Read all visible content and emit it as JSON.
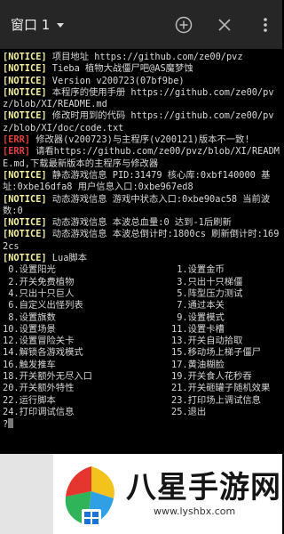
{
  "titlebar": {
    "window_label": "窗口 1",
    "icons": [
      "chevron-down-icon",
      "plus-circle-icon",
      "close-icon",
      "more-vert-icon"
    ]
  },
  "colors": {
    "notice": "#f5f0a0",
    "error": "#e04040",
    "text": "#d8d8d8",
    "background": "#000000",
    "titlebar": "#262626"
  },
  "terminal": {
    "log": [
      {
        "tag": "[NOTICE]",
        "type": "notice",
        "text": " 项目地址 https://github.com/ze00/pvz"
      },
      {
        "tag": "[NOTICE]",
        "type": "notice",
        "text": " Tieba 植物大战僵尸吧@AS魔梦蚀"
      },
      {
        "tag": "[NOTICE]",
        "type": "notice",
        "text": " Version v200723(07bf9be)"
      },
      {
        "tag": "[NOTICE]",
        "type": "notice",
        "text": " 本程序的使用手册 https://github.com/ze00/pvz/blob/XI/README.md"
      },
      {
        "tag": "[NOTICE]",
        "type": "notice",
        "text": " 修改时用到的代码 https://github.com/ze00/pvz/blob/XI/doc/code.txt"
      },
      {
        "tag": "[ERR]",
        "type": "err",
        "text": " 修改器(v200723)与主程序(v200121)版本不一致!"
      },
      {
        "tag": "[ERR]",
        "type": "err",
        "text": " 请看https://github.com/ze00/pvz/blob/XI/README.md,下载最新版本的主程序与修改器"
      },
      {
        "tag": "[NOTICE]",
        "type": "notice",
        "text": " 静态游戏信息 PID:31479 核心库:0xbf140000 基址:0xbe16dfa8 用户信息入口:0xbe967ed8"
      },
      {
        "tag": "[NOTICE]",
        "type": "notice",
        "text": " 动态游戏信息 游戏中状态入口:0xbe90ac58 当前波数:0"
      },
      {
        "tag": "[NOTICE]",
        "type": "notice",
        "text": " 动态游戏信息 本波总血量:0 达到-1后刷新"
      },
      {
        "tag": "[NOTICE]",
        "type": "notice",
        "text": " 动态游戏信息 本波总倒计时:1800cs 刷新倒计时:1692cs"
      },
      {
        "tag": "[NOTICE]",
        "type": "notice",
        "text": " Lua脚本"
      }
    ],
    "menu": [
      " 0.设置阳光",
      " 1.设置金币",
      " 2.开关免费植物",
      " 3.只出十只梯僵",
      " 4.只出十只巨人",
      " 5.阵型压力测试",
      " 6.自定义出怪列表",
      " 7.通过本关",
      " 8.设置旗数",
      " 9.设置模式",
      "10.设置场景",
      "11.设置卡槽",
      "12.设置冒险关卡",
      "13.开关自动拾取",
      "14.解锁各游戏模式",
      "15.移动场上梯子僵尸",
      "16.触发推车",
      "17.黄油糊脸",
      "18.开关额外无尽入口",
      "19.开关食人花秒吞",
      "20.开关额外特性",
      "21.开关砸罐子随机效果",
      "22.运行脚本",
      "23.打印场上调试信息",
      "24.打印调试信息",
      "25.退出"
    ],
    "prompt": "?"
  },
  "watermark": {
    "brand": "八星手游网",
    "domain": "www.lyshbx.com"
  }
}
